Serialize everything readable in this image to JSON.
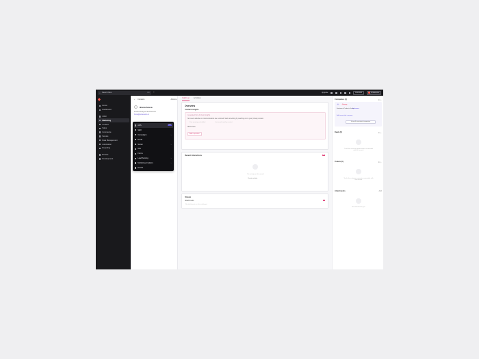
{
  "topbar": {
    "search_placeholder": "Search files",
    "search_kbd": "⌘K",
    "upgrade": "Upgrade",
    "assistant": "Assistant",
    "brand": "Endeavour",
    "colors": {
      "bar": "#19191c",
      "avatar": "#ff5a4f"
    }
  },
  "sidebar": {
    "items": [
      {
        "label": "Home",
        "icon": "home-icon"
      },
      {
        "label": "Dashboard",
        "icon": "dashboard-icon"
      },
      {
        "label": "CRM",
        "icon": "crm-icon"
      },
      {
        "label": "Marketing",
        "icon": "megaphone-icon",
        "active": true
      },
      {
        "label": "Content",
        "icon": "content-icon"
      },
      {
        "label": "Sales",
        "icon": "sales-icon"
      },
      {
        "label": "Commerce",
        "icon": "commerce-icon"
      },
      {
        "label": "Service",
        "icon": "service-icon"
      },
      {
        "label": "Data Management",
        "icon": "data-icon"
      },
      {
        "label": "Automation",
        "icon": "automation-icon"
      },
      {
        "label": "Reporting",
        "icon": "reporting-icon"
      },
      {
        "label": "Browse",
        "icon": "browse-icon"
      },
      {
        "label": "Development",
        "icon": "development-icon"
      }
    ]
  },
  "contact": {
    "breadcrumb": "Contacts",
    "actions": "Actions",
    "name": "Bruna Sousa",
    "subtitle": "Product Designer at Endeavour",
    "email": "bruna@endeavour.co"
  },
  "marketing_menu": {
    "items": [
      {
        "label": "ADS",
        "selected": true,
        "badge": "New"
      },
      {
        "label": "SEO"
      },
      {
        "label": "Campaigns",
        "chevron": true
      },
      {
        "label": "Email"
      },
      {
        "label": "Social",
        "chevron": true
      },
      {
        "label": "Ads"
      },
      {
        "label": "Forms"
      },
      {
        "label": "Lead Scoring",
        "chevron": true
      },
      {
        "label": "Marketing Analytics",
        "chevron": true
      },
      {
        "label": "Events"
      }
    ]
  },
  "main": {
    "tabs": [
      "Catch up",
      "Activities"
    ],
    "overview": {
      "title": "Overview",
      "section": "Contact insights",
      "banner_heading": "Generated from AI client insights",
      "banner_text": "No recent activities or communications are recorded. Start something by reaching out to your primary contact.",
      "hints": [
        "First meeting scheduled",
        "Last email sent by contact"
      ],
      "show_more": "Show more",
      "button": "Add a question"
    },
    "recent": {
      "title": "Recent Interactions",
      "badge": "All",
      "empty": "No activity on this record",
      "action": "Create activity"
    },
    "stream": {
      "title": "Stream",
      "label": "Attachments",
      "badge": "1",
      "empty": "No attachments on this activity yet"
    }
  },
  "right_panel": {
    "companies": {
      "title": "Companies (1)",
      "chip": "Primary",
      "name": "Endeavour",
      "desc": "Endeavour Products Group",
      "link": "Add associated company",
      "button": "View all associated companies"
    },
    "deals": {
      "title": "Deals (0)",
      "empty": "Track the revenue opportunities associated with this record."
    },
    "tickets": {
      "title": "Tickets (0)",
      "empty": "Track the customer requests associated with this record."
    },
    "attachments": {
      "title": "Attachments",
      "control": "Add",
      "empty": "No attachments yet"
    }
  }
}
